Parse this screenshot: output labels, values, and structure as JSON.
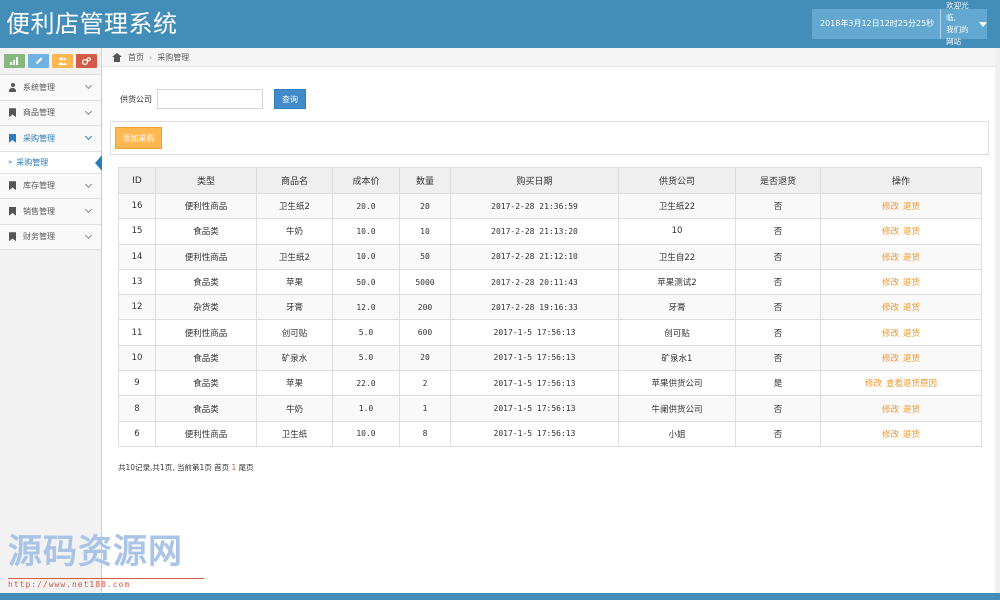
{
  "header": {
    "title": "便利店管理系统",
    "datetime": "2018年3月12日12时25分25秒",
    "welcome_line1": "欢迎光临,",
    "welcome_line2": "我们的网站"
  },
  "shortcuts": [
    {
      "icon": "signal-icon",
      "color": "#87b87f"
    },
    {
      "icon": "pencil-icon",
      "color": "#6fb3e0"
    },
    {
      "icon": "users-icon",
      "color": "#ffb752"
    },
    {
      "icon": "cogs-icon",
      "color": "#d15b47"
    }
  ],
  "sidebar": {
    "items": [
      {
        "label": "系统管理"
      },
      {
        "label": "商品管理"
      },
      {
        "label": "采购管理"
      },
      {
        "label": "库存管理"
      },
      {
        "label": "销售管理"
      },
      {
        "label": "财务管理"
      }
    ],
    "sub_item": "采购管理"
  },
  "breadcrumb": {
    "home": "首页",
    "current": "采购管理"
  },
  "search": {
    "label": "供货公司",
    "value": "",
    "button": "查询"
  },
  "add_button": "添加采购",
  "table": {
    "columns": [
      "ID",
      "类型",
      "商品名",
      "成本价",
      "数量",
      "购买日期",
      "供货公司",
      "是否退货",
      "操作"
    ],
    "rows": [
      {
        "id": "16",
        "type": "便利性商品",
        "name": "卫生纸2",
        "cost": "20.0",
        "qty": "20",
        "date": "2017-2-28 21:36:59",
        "supplier": "卫生纸22",
        "returned": "否",
        "op1": "修改",
        "op2": "退货"
      },
      {
        "id": "15",
        "type": "食品类",
        "name": "牛奶",
        "cost": "10.0",
        "qty": "10",
        "date": "2017-2-28 21:13:20",
        "supplier": "10",
        "returned": "否",
        "op1": "修改",
        "op2": "退货"
      },
      {
        "id": "14",
        "type": "便利性商品",
        "name": "卫生纸2",
        "cost": "10.0",
        "qty": "50",
        "date": "2017-2-28 21:12:10",
        "supplier": "卫生自22",
        "returned": "否",
        "op1": "修改",
        "op2": "退货"
      },
      {
        "id": "13",
        "type": "食品类",
        "name": "苹果",
        "cost": "50.0",
        "qty": "5000",
        "date": "2017-2-28 20:11:43",
        "supplier": "苹果测试2",
        "returned": "否",
        "op1": "修改",
        "op2": "退货"
      },
      {
        "id": "12",
        "type": "杂货类",
        "name": "牙膏",
        "cost": "12.0",
        "qty": "200",
        "date": "2017-2-28 19:16:33",
        "supplier": "牙膏",
        "returned": "否",
        "op1": "修改",
        "op2": "退货"
      },
      {
        "id": "11",
        "type": "便利性商品",
        "name": "创可贴",
        "cost": "5.0",
        "qty": "600",
        "date": "2017-1-5 17:56:13",
        "supplier": "创可贴",
        "returned": "否",
        "op1": "修改",
        "op2": "退货"
      },
      {
        "id": "10",
        "type": "食品类",
        "name": "矿泉水",
        "cost": "5.0",
        "qty": "20",
        "date": "2017-1-5 17:56:13",
        "supplier": "矿泉水1",
        "returned": "否",
        "op1": "修改",
        "op2": "退货"
      },
      {
        "id": "9",
        "type": "食品类",
        "name": "苹果",
        "cost": "22.0",
        "qty": "2",
        "date": "2017-1-5 17:56:13",
        "supplier": "苹果供货公司",
        "returned": "是",
        "op1": "修改",
        "op2": "查看退货原因"
      },
      {
        "id": "8",
        "type": "食品类",
        "name": "牛奶",
        "cost": "1.0",
        "qty": "1",
        "date": "2017-1-5 17:56:13",
        "supplier": "牛阑供货公司",
        "returned": "否",
        "op1": "修改",
        "op2": "退货"
      },
      {
        "id": "6",
        "type": "便利性商品",
        "name": "卫生纸",
        "cost": "10.0",
        "qty": "8",
        "date": "2017-1-5 17:56:13",
        "supplier": "小姐",
        "returned": "否",
        "op1": "修改",
        "op2": "退货"
      }
    ]
  },
  "pager": {
    "summary": "共10记录,共1页, 当前第1页 首页 ",
    "page_num": "1",
    "last": " 尾页"
  },
  "watermark": {
    "title": "源码资源网",
    "url": "http://www.net188.com"
  }
}
